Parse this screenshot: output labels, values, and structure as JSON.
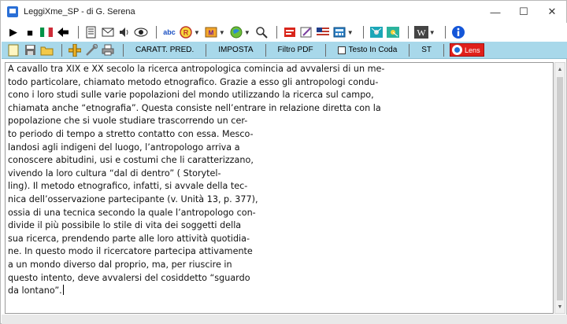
{
  "window": {
    "title": "LeggiXme_SP - di G. Serena",
    "controls": [
      "—",
      "☐",
      "✕"
    ]
  },
  "toolbar1": {
    "groups": [
      [
        "play-icon",
        "stop-icon",
        "italy-flag-icon",
        "back-arrow-icon"
      ],
      [
        "pages-icon",
        "mail-icon",
        "speaker-icon",
        "eye-icon"
      ],
      [
        "spellcheck-icon",
        "reader-icon",
        "mp3-icon",
        "globe-icon",
        "search-icon"
      ],
      [
        "pdf-icon",
        "pen-icon",
        "usa-flag-icon",
        "calculator-icon"
      ],
      [
        "mind-map-icon",
        "colored-map-icon"
      ],
      [
        "wikipedia-icon"
      ],
      [
        "info-icon"
      ]
    ],
    "glyphs": {
      "play-icon": "▶",
      "stop-icon": "■",
      "italy-flag-icon": "▮",
      "back-arrow-icon": "◆",
      "pages-icon": "▤",
      "mail-icon": "✉",
      "speaker-icon": "🔈",
      "eye-icon": "👁",
      "spellcheck-icon": "ab",
      "reader-icon": "®",
      "mp3-icon": "M",
      "globe-icon": "●",
      "search-icon": "🔍",
      "pdf-icon": "▬",
      "pen-icon": "✎",
      "usa-flag-icon": "▦",
      "calculator-icon": "▦",
      "mind-map-icon": "✶",
      "colored-map-icon": "✶",
      "wikipedia-icon": "W",
      "info-icon": "ℹ"
    }
  },
  "toolbar2": {
    "carat_pred": "CARATT. PRED.",
    "imposta": "IMPOSTA",
    "filtro_pdf": "Filtro PDF",
    "testo_in_coda": "Testo In Coda",
    "st": "ST",
    "lens": "Lens"
  },
  "document": {
    "lines": [
      "A cavallo tra XIX e XX secolo la ricerca antropologica comincia ad avvalersi di un me-",
      "todo particolare, chiamato metodo etnografico. Grazie a esso gli antropologi condu-",
      "cono i loro studi sulle varie popolazioni del mondo utilizzando la ricerca sul campo,",
      "chiamata anche “etnografia”. Questa consiste nell’entrare in relazione diretta con la",
      "popolazione che si vuole studiare trascorrendo un cer-",
      "to periodo di tempo a stretto contatto con essa. Mesco-",
      "landosi agli indigeni del luogo, l’antropologo arriva a",
      "conoscere abitudini, usi e costumi che li caratterizzano,",
      "vivendo la loro cultura “dal di dentro” ( Storytel-",
      "ling). Il metodo etnografico, infatti, si avvale della tec-",
      "nica dell’osservazione partecipante (v. Unità 13, p. 377),",
      "ossia di una tecnica secondo la quale l’antropologo con-",
      "divide il più possibile lo stile di vita dei soggetti della",
      "sua ricerca, prendendo parte alle loro attività quotidia-",
      "ne. In questo modo il ricercatore partecipa attivamente",
      "a un mondo diverso dal proprio, ma, per riuscire in",
      "questo intento, deve avvalersi del cosiddetto “sguardo",
      "da lontano”."
    ]
  },
  "colors": {
    "toolbar2_bg": "#a8d8ea",
    "lens_red": "#e0201b"
  }
}
